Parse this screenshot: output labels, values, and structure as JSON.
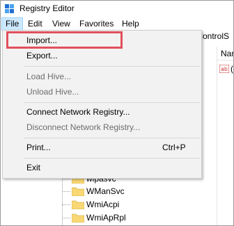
{
  "window": {
    "title": "Registry Editor"
  },
  "menubar": {
    "file": "File",
    "edit": "Edit",
    "view": "View",
    "favorites": "Favorites",
    "help": "Help"
  },
  "address": {
    "text": "tControlS"
  },
  "list": {
    "header": "Nar",
    "first_value_paren": "("
  },
  "file_menu": {
    "import": "Import...",
    "export": "Export...",
    "load_hive": "Load Hive...",
    "unload_hive": "Unload Hive...",
    "connect": "Connect Network Registry...",
    "disconnect": "Disconnect Network Registry...",
    "print": "Print...",
    "print_shortcut": "Ctrl+P",
    "exit": "Exit"
  },
  "tree": {
    "items": [
      "wlpasvc",
      "WManSvc",
      "WmiAcpi",
      "WmiApRpl"
    ]
  },
  "colors": {
    "highlight": "#e2505c",
    "menu_bg": "#f2f2f2",
    "menu_hover": "#cce8ff",
    "folder": "#f8d775"
  }
}
